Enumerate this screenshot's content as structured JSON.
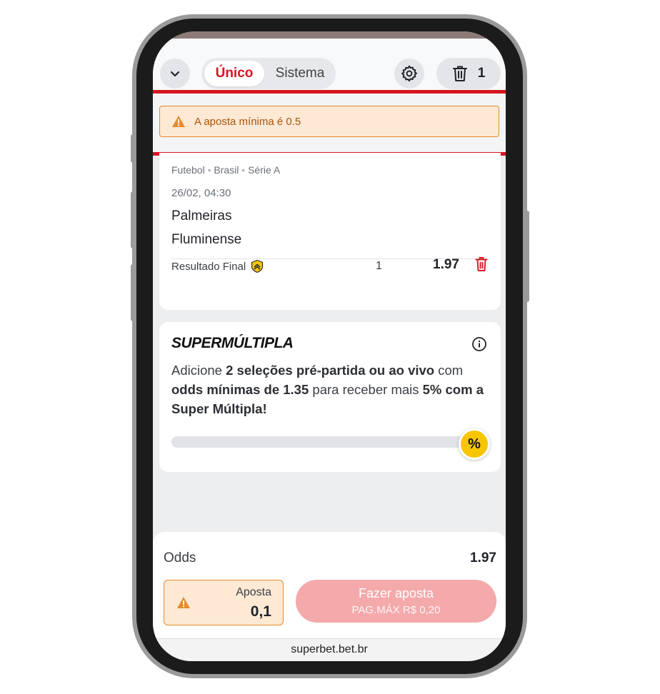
{
  "header": {
    "toggle_active": "Único",
    "toggle_inactive": "Sistema",
    "selection_count": "1"
  },
  "warning": {
    "message": "A aposta mínima é 0.5"
  },
  "event": {
    "breadcrumb": [
      "Futebol",
      "Brasil",
      "Série A"
    ],
    "datetime": "26/02, 04:30",
    "home_team": "Palmeiras",
    "away_team": "Fluminense",
    "market": "Resultado Final",
    "pick": "1",
    "odd": "1.97"
  },
  "supermultipla": {
    "title": "SUPERMÚLTIPLA",
    "text_1": "Adicione ",
    "bold_1": "2 seleções pré-partida ou ao vivo",
    "text_2": " com ",
    "bold_2": "odds mínimas de 1.35",
    "text_3": " para receber mais ",
    "bold_3": "5% com a Super Múltipla!",
    "badge": "%"
  },
  "footer": {
    "odds_label": "Odds",
    "odds_value": "1.97",
    "stake_label": "Aposta",
    "stake_value": "0,1",
    "place_bet_label": "Fazer aposta",
    "max_payout": "PAG.MÁX R$ 0,20"
  },
  "browser": {
    "url": "superbet.bet.br"
  },
  "colors": {
    "brand_red": "#d7151f",
    "warning_orange": "#e58b2f",
    "warning_bg": "#fde9d4",
    "disabled_button": "#f4a9ab",
    "badge_yellow": "#f7c600"
  }
}
